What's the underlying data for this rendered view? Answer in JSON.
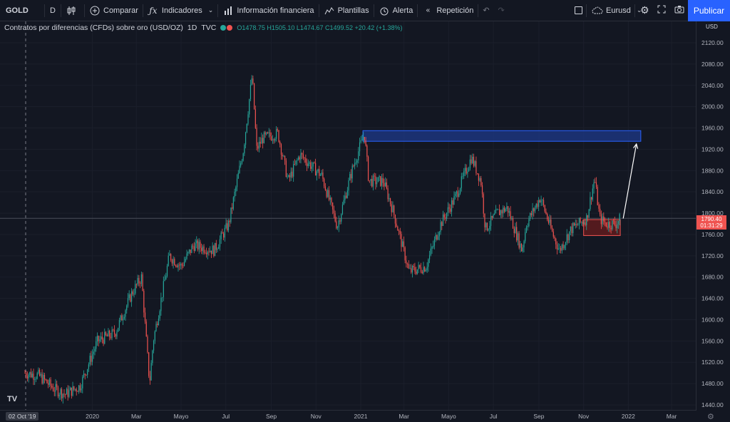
{
  "toolbar": {
    "symbol": "GOLD",
    "interval": "D",
    "compare_label": "Comparar",
    "indicators_label": "Indicadores",
    "financials_label": "Información financiera",
    "templates_label": "Plantillas",
    "alert_label": "Alerta",
    "replay_label": "Repetición",
    "layout_name": "Eurusd",
    "publish_label": "Publicar"
  },
  "legend": {
    "title": "Contratos por diferencias (CFDs) sobre oro (USD/OZ)",
    "interval": "1D",
    "source": "TVC",
    "ohlc": "O1478.75 H1505.10 L1474.67 C1499.52 +20.42 (+1.38%)"
  },
  "price_axis": {
    "currency": "USD",
    "ticks": [
      "2120.00",
      "2080.00",
      "2040.00",
      "2000.00",
      "1960.00",
      "1920.00",
      "1880.00",
      "1840.00",
      "1800.00",
      "1760.00",
      "1720.00",
      "1680.00",
      "1640.00",
      "1600.00",
      "1560.00",
      "1520.00",
      "1480.00",
      "1440.00"
    ],
    "current_price": "1790.40",
    "countdown": "01:31:29"
  },
  "time_axis": {
    "ticks": [
      "2020",
      "Mar",
      "Mayo",
      "Jul",
      "Sep",
      "Nov",
      "2021",
      "Mar",
      "Mayo",
      "Jul",
      "Sep",
      "Nov",
      "2022",
      "Mar"
    ],
    "cursor_label": "02 Oct '19"
  },
  "logo_text": "TV",
  "colors": {
    "background": "#131722",
    "up": "#26a69a",
    "down": "#ef5350",
    "accent": "#2962ff",
    "resistance_zone": "#1e3a8a",
    "support_zone": "#7f1d1d"
  },
  "chart_data": {
    "type": "candlestick",
    "title": "Contratos por diferencias (CFDs) sobre oro (USD/OZ)",
    "ylim": [
      1430,
      2150
    ],
    "series": [
      {
        "name": "GOLD",
        "keyframes": [
          [
            "2019-10-01",
            1500
          ],
          [
            "2019-10-20",
            1495
          ],
          [
            "2019-11-10",
            1470
          ],
          [
            "2019-11-25",
            1460
          ],
          [
            "2019-12-15",
            1475
          ],
          [
            "2020-01-08",
            1560
          ],
          [
            "2020-02-01",
            1575
          ],
          [
            "2020-02-24",
            1650
          ],
          [
            "2020-03-08",
            1680
          ],
          [
            "2020-03-19",
            1480
          ],
          [
            "2020-03-24",
            1560
          ],
          [
            "2020-04-15",
            1720
          ],
          [
            "2020-05-01",
            1700
          ],
          [
            "2020-05-18",
            1740
          ],
          [
            "2020-06-15",
            1730
          ],
          [
            "2020-07-05",
            1780
          ],
          [
            "2020-07-25",
            1920
          ],
          [
            "2020-08-06",
            2060
          ],
          [
            "2020-08-12",
            1920
          ],
          [
            "2020-08-20",
            1940
          ],
          [
            "2020-09-10",
            1950
          ],
          [
            "2020-09-24",
            1860
          ],
          [
            "2020-10-10",
            1910
          ],
          [
            "2020-11-09",
            1870
          ],
          [
            "2020-11-30",
            1775
          ],
          [
            "2020-12-20",
            1880
          ],
          [
            "2021-01-06",
            1950
          ],
          [
            "2021-01-12",
            1860
          ],
          [
            "2021-02-01",
            1860
          ],
          [
            "2021-02-15",
            1800
          ],
          [
            "2021-03-08",
            1690
          ],
          [
            "2021-03-31",
            1700
          ],
          [
            "2021-04-20",
            1780
          ],
          [
            "2021-05-10",
            1830
          ],
          [
            "2021-06-01",
            1905
          ],
          [
            "2021-06-14",
            1860
          ],
          [
            "2021-06-20",
            1770
          ],
          [
            "2021-07-06",
            1800
          ],
          [
            "2021-07-20",
            1810
          ],
          [
            "2021-08-09",
            1730
          ],
          [
            "2021-08-15",
            1780
          ],
          [
            "2021-09-03",
            1830
          ],
          [
            "2021-09-20",
            1760
          ],
          [
            "2021-09-29",
            1730
          ],
          [
            "2021-10-15",
            1770
          ],
          [
            "2021-11-05",
            1790
          ],
          [
            "2021-11-16",
            1865
          ],
          [
            "2021-11-23",
            1790
          ],
          [
            "2021-12-02",
            1780
          ],
          [
            "2021-12-15",
            1780
          ],
          [
            "2021-12-21",
            1790
          ]
        ]
      }
    ],
    "annotations": {
      "resistance_zone": {
        "from": "2021-01-04",
        "to": "2022-01-18",
        "price_low": 1935,
        "price_high": 1955
      },
      "support_zone": {
        "from": "2021-11-01",
        "to": "2021-12-21",
        "price_low": 1758,
        "price_high": 1788
      },
      "arrow": {
        "from": [
          "2021-12-25",
          1790
        ],
        "to": [
          "2022-01-12",
          1930
        ]
      },
      "crosshair_price": 1790.4
    }
  }
}
